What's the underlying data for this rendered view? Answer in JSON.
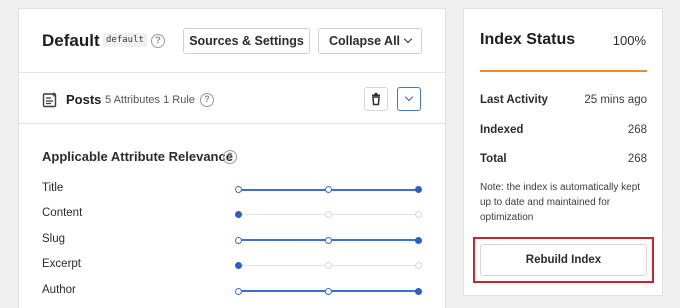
{
  "engine": {
    "title": "Default",
    "slug": "default",
    "help_glyph": "?",
    "sources_button_label": "Sources & Settings",
    "collapse_button_label": "Collapse All"
  },
  "source": {
    "name": "Posts",
    "meta": "5 Attributes 1 Rule",
    "icon": "document-icon",
    "delete_icon": "trash-icon",
    "expand_icon": "chevron-down-icon"
  },
  "relevance": {
    "title": "Applicable Attribute Relevance",
    "attributes": [
      {
        "label": "Title",
        "level": 1.0
      },
      {
        "label": "Content",
        "level": 0.0
      },
      {
        "label": "Slug",
        "level": 1.0
      },
      {
        "label": "Excerpt",
        "level": 0.0
      },
      {
        "label": "Author",
        "level": 1.0
      }
    ],
    "accent_color": "#3d6fd4"
  },
  "index_status": {
    "title": "Index Status",
    "percent_label": "100%",
    "progress": 1.0,
    "progress_color": "#f08a24",
    "rows": [
      {
        "label": "Last Activity",
        "value": "25 mins ago"
      },
      {
        "label": "Indexed",
        "value": "268"
      },
      {
        "label": "Total",
        "value": "268"
      }
    ],
    "note": "Note: the index is automatically kept up to date and maintained for optimization",
    "rebuild_label": "Rebuild Index",
    "highlight_color": "#c4262e"
  }
}
